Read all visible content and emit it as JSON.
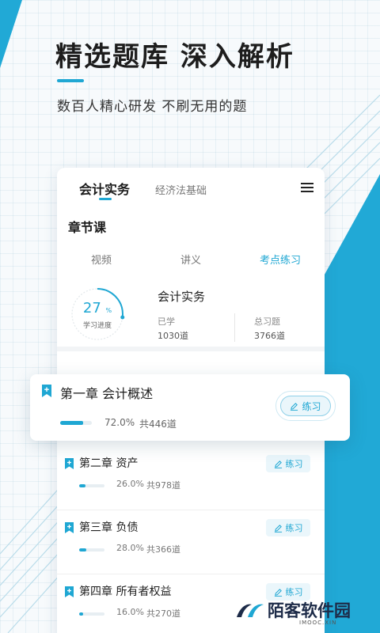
{
  "colors": {
    "accent": "#1fa7d3",
    "dark_text": "#1b1b1b",
    "blue_shape": "#21a9d6"
  },
  "header": {
    "headline": "精选题库  深入解析",
    "subline": "数百人精心研发 不刷无用的题"
  },
  "tabs": {
    "active": "会计实务",
    "inactive": "经济法基础",
    "menu_icon": "menu-icon"
  },
  "section": {
    "title": "章节课",
    "subtabs": [
      "视频",
      "讲义",
      "考点练习"
    ],
    "active_subtab": "考点练习"
  },
  "summary": {
    "progress_value": "27",
    "progress_unit": "%",
    "progress_fraction": 0.27,
    "progress_label": "学习进度",
    "course_title": "会计实务",
    "learned_label": "已学",
    "learned_value": "1030道",
    "total_label": "总习题",
    "total_value": "3766道"
  },
  "featured_chapter": {
    "title": "第一章 会计概述",
    "percent": "72.0%",
    "count": "共446道",
    "fraction": 0.72,
    "button": "练习"
  },
  "chapters": [
    {
      "title": "第二章 资产",
      "percent": "26.0%",
      "count": "共978道",
      "fraction": 0.26,
      "button": "练习"
    },
    {
      "title": "第三章 负债",
      "percent": "28.0%",
      "count": "共366道",
      "fraction": 0.28,
      "button": "练习"
    },
    {
      "title": "第四章 所有者权益",
      "percent": "16.0%",
      "count": "共270道",
      "fraction": 0.16,
      "button": "练习"
    }
  ],
  "watermark": {
    "name": "陌客软件园",
    "domain": "IMOOC.XIN"
  }
}
